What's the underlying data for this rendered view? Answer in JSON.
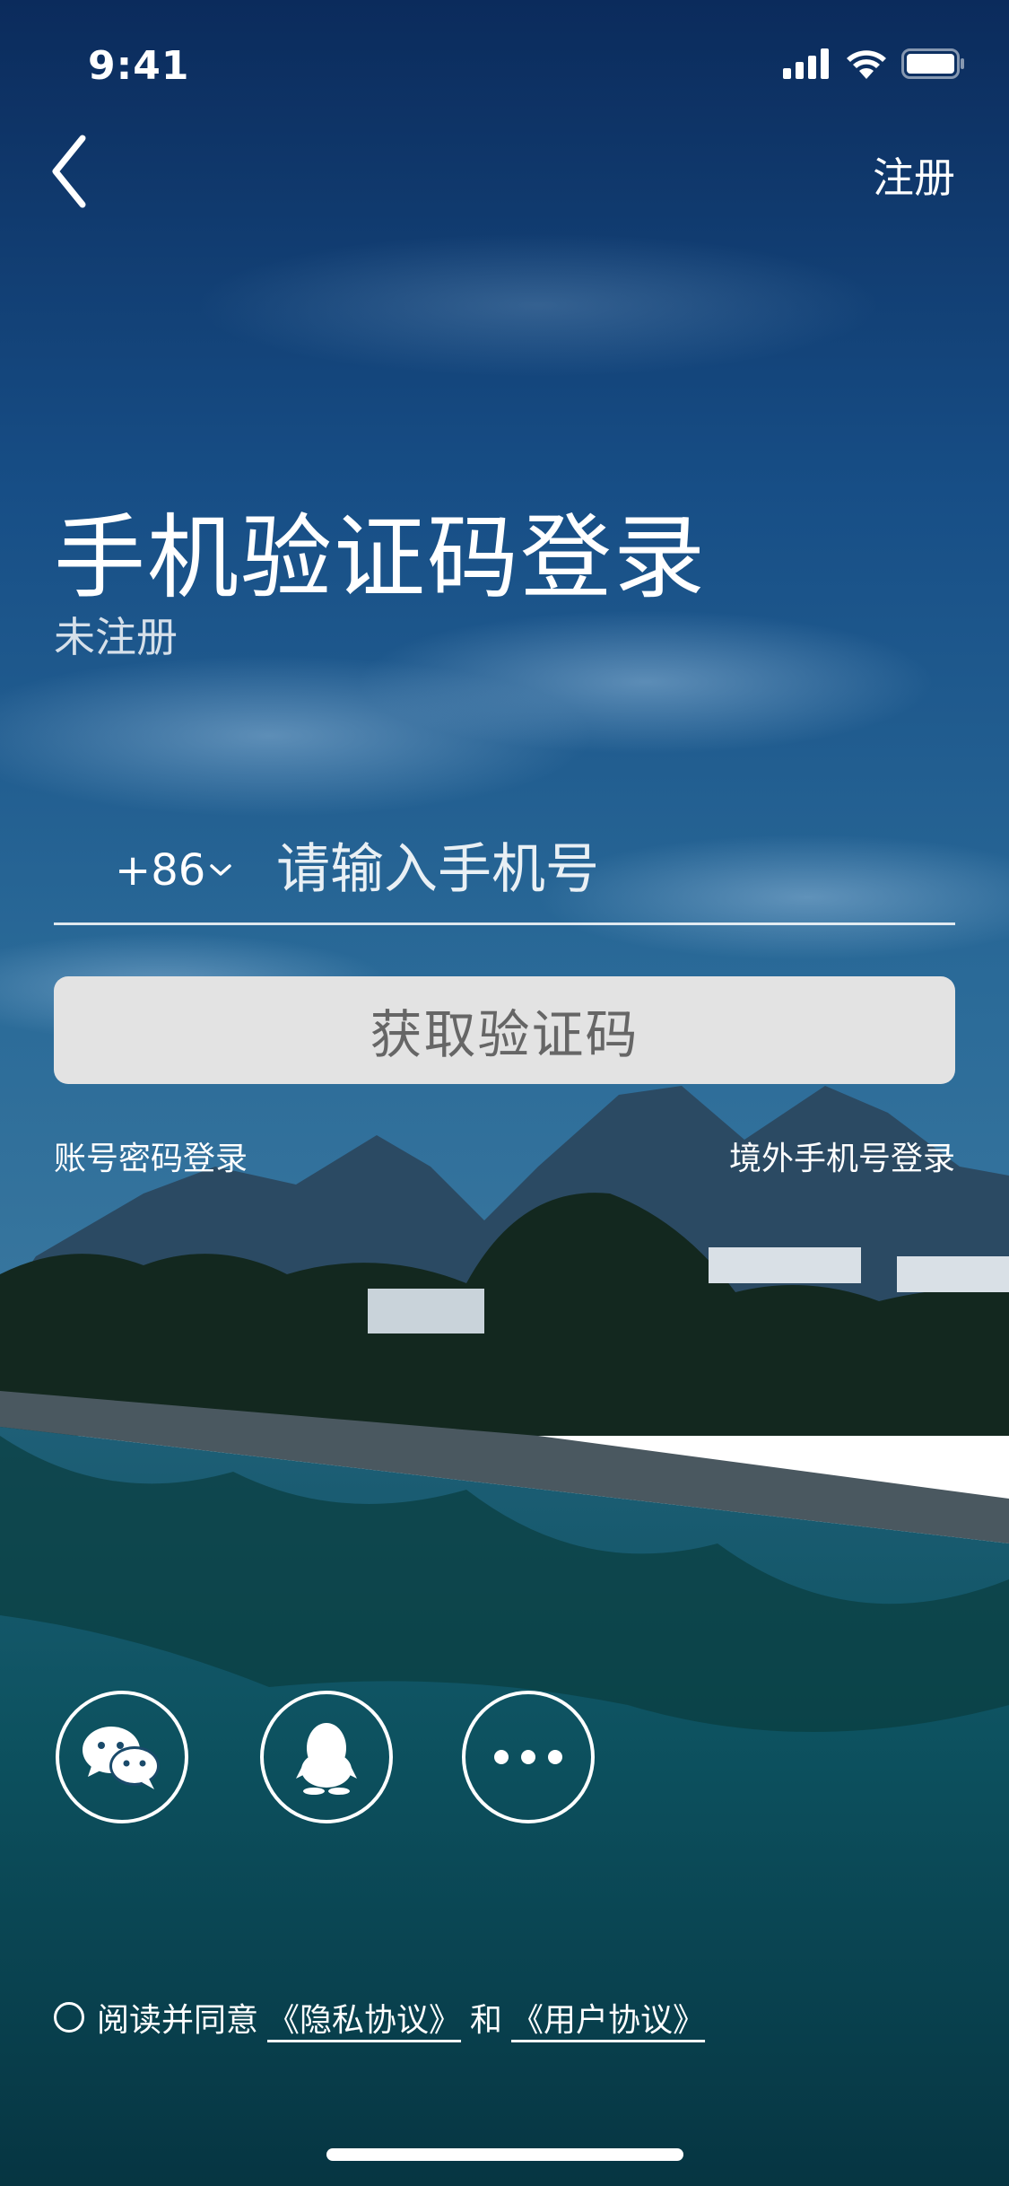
{
  "status_bar": {
    "time": "9:41"
  },
  "nav": {
    "register_label": "注册"
  },
  "header": {
    "title": "手机验证码登录",
    "subtitle": "未注册"
  },
  "phone": {
    "country_code": "+86",
    "placeholder": "请输入手机号",
    "value": ""
  },
  "verify_button": {
    "label": "获取验证码"
  },
  "links": {
    "password_login": "账号密码登录",
    "overseas_login": "境外手机号登录"
  },
  "social_login": [
    {
      "icon": "wechat-icon"
    },
    {
      "icon": "qq-icon"
    },
    {
      "icon": "more-icon"
    }
  ],
  "agreement": {
    "prefix": "阅读并同意",
    "privacy": "《隐私协议》",
    "conjunction": "和",
    "user": "《用户协议》"
  },
  "colors": {
    "sky_top": "#0d2f63",
    "sky_mid": "#1d5d90",
    "water": "#0b5060",
    "button_bg": "#e3e3e3",
    "button_text": "#666666"
  }
}
